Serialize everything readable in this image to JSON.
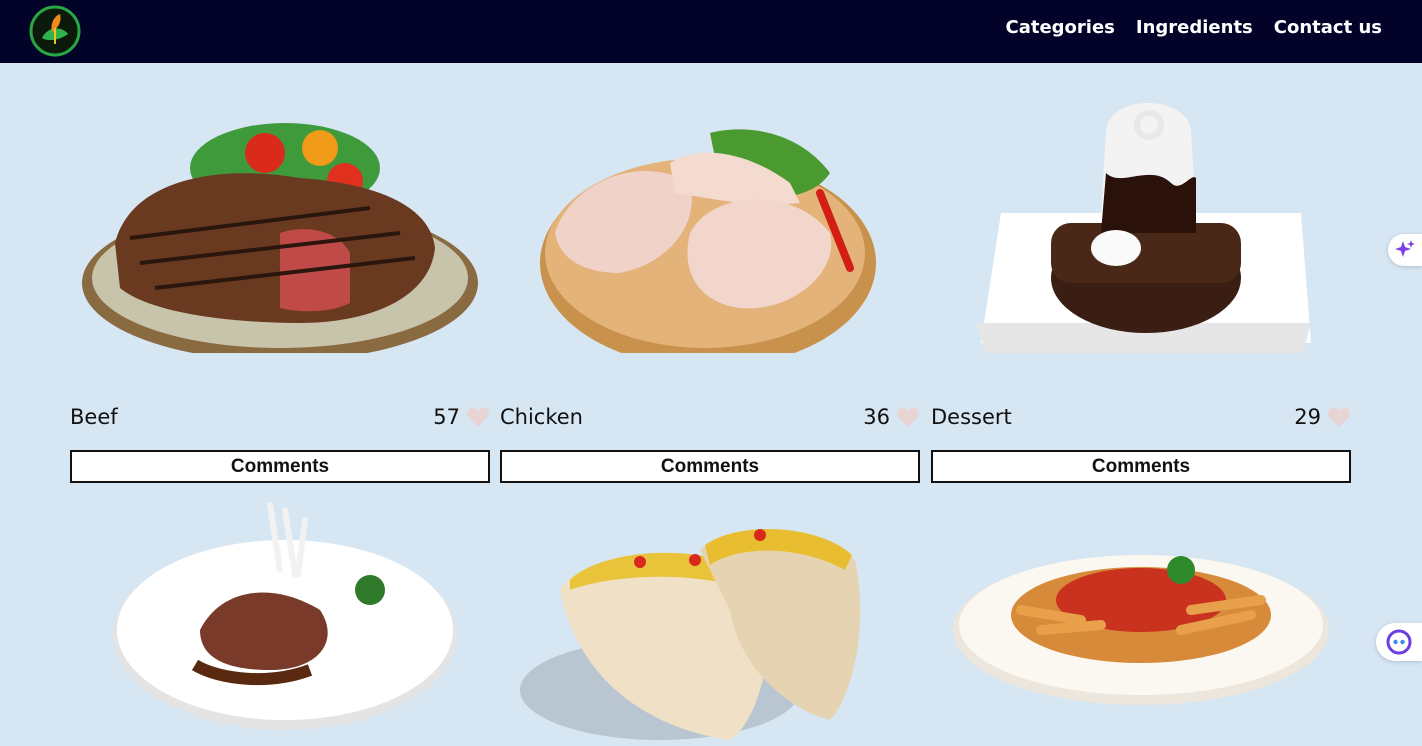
{
  "nav": {
    "links": [
      "Categories",
      "Ingredients",
      "Contact us"
    ]
  },
  "cards": [
    {
      "name": "Beef",
      "likes": "57",
      "button": "Comments",
      "image": "steak-plate"
    },
    {
      "name": "Chicken",
      "likes": "36",
      "button": "Comments",
      "image": "raw-chicken-board"
    },
    {
      "name": "Dessert",
      "likes": "29",
      "button": "Comments",
      "image": "chocolate-cake"
    },
    {
      "name": "",
      "likes": "",
      "button": "",
      "image": "lamb-chops-plate"
    },
    {
      "name": "",
      "likes": "",
      "button": "",
      "image": "tacos"
    },
    {
      "name": "",
      "likes": "",
      "button": "",
      "image": "pasta-bowl"
    }
  ],
  "colors": {
    "navbar": "#03032a",
    "background": "#d6e6f3",
    "heart": "#e8d4d4",
    "accent": "#7b3fe4"
  },
  "icons": [
    "leaf-logo-icon",
    "heart-icon",
    "sparkle-icon",
    "assistant-face-icon"
  ]
}
